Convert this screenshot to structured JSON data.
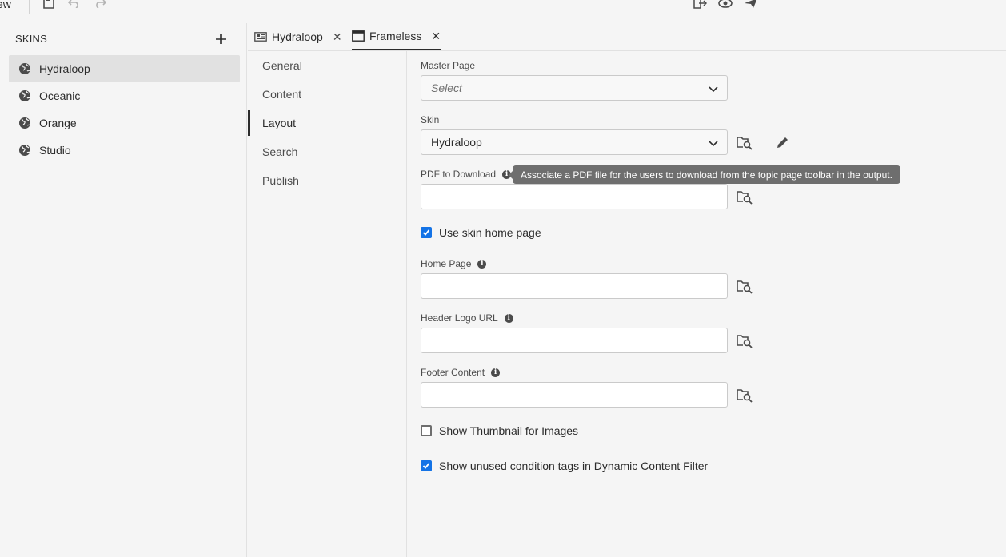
{
  "toolbar": {
    "truncated_label": "ew"
  },
  "skins_panel": {
    "header": "SKINS",
    "items": [
      {
        "label": "Hydraloop",
        "selected": true
      },
      {
        "label": "Oceanic",
        "selected": false
      },
      {
        "label": "Orange",
        "selected": false
      },
      {
        "label": "Studio",
        "selected": false
      }
    ]
  },
  "tabs": [
    {
      "label": "Hydraloop",
      "active": false
    },
    {
      "label": "Frameless",
      "active": true
    }
  ],
  "side_nav": {
    "items": [
      {
        "label": "General",
        "active": false
      },
      {
        "label": "Content",
        "active": false
      },
      {
        "label": "Layout",
        "active": true
      },
      {
        "label": "Search",
        "active": false
      },
      {
        "label": "Publish",
        "active": false
      }
    ]
  },
  "form": {
    "master_page": {
      "label": "Master Page",
      "placeholder": "Select"
    },
    "skin": {
      "label": "Skin",
      "value": "Hydraloop"
    },
    "pdf_download": {
      "label": "PDF to Download",
      "value": ""
    },
    "tooltip": "Associate a PDF file for the users to download from the topic page toolbar in the output.",
    "use_skin_home": {
      "label": "Use skin home page",
      "checked": true
    },
    "home_page": {
      "label": "Home Page",
      "value": ""
    },
    "header_logo": {
      "label": "Header Logo URL",
      "value": ""
    },
    "footer_content": {
      "label": "Footer Content",
      "value": ""
    },
    "show_thumbnail": {
      "label": "Show Thumbnail for Images",
      "checked": false
    },
    "show_unused_tags": {
      "label": "Show unused condition tags in Dynamic Content Filter",
      "checked": true
    }
  },
  "colors": {
    "accent": "#1473e6",
    "tooltip_bg": "#6e6e6e",
    "selected_bg": "#e1e1e1"
  }
}
